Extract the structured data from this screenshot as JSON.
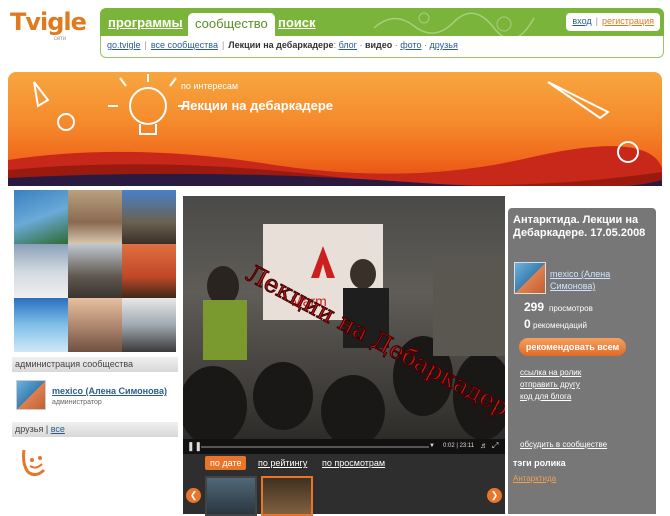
{
  "header": {
    "logo": {
      "text": "Tvigle",
      "sub": "сети"
    },
    "tabs": [
      {
        "label": "программы",
        "active": false
      },
      {
        "label": "сообщество",
        "active": true
      },
      {
        "label": "поиск",
        "active": false
      }
    ],
    "login": "вход",
    "register": "регистрация"
  },
  "subnav": {
    "items": [
      "go.tvigle",
      "все сообщества"
    ],
    "current": "Лекции на дебаркадере",
    "blog": "блог",
    "video": "видео",
    "photo": "фото",
    "friends": "друзья"
  },
  "banner": {
    "subtitle": "по интересам",
    "title": "Лекции на дебаркадере"
  },
  "left": {
    "admin_header": "администрация сообщества",
    "admin_name": "mexico (Алена Симонова)",
    "admin_role": "администратор",
    "friends_header": "друзья",
    "friends_all": "все"
  },
  "video": {
    "overlay_text": "Лекции на Дебаркадере",
    "sign_text": "Marm",
    "time": "0:02 | 23:11",
    "sort_tabs": [
      "по дате",
      "по рейтингу",
      "по просмотрам"
    ]
  },
  "info": {
    "title": "Антарктида. Лекции на Дебаркадере. 17.05.2008",
    "user": "mexico (Алена Симонова)",
    "views": "299",
    "views_label": "просмотров",
    "recs": "0",
    "recs_label": "рекомендаций",
    "recommend_btn": "рекомендовать всем",
    "links": [
      "ссылка на ролик",
      "отправить другу",
      "код для блога"
    ],
    "discuss": "обсудить в сообществе",
    "tags_header": "тэги ролика",
    "tag": "Антарктида"
  },
  "colors": {
    "green": "#7bb43a",
    "orange": "#e8752a",
    "info_bg": "#777777"
  }
}
